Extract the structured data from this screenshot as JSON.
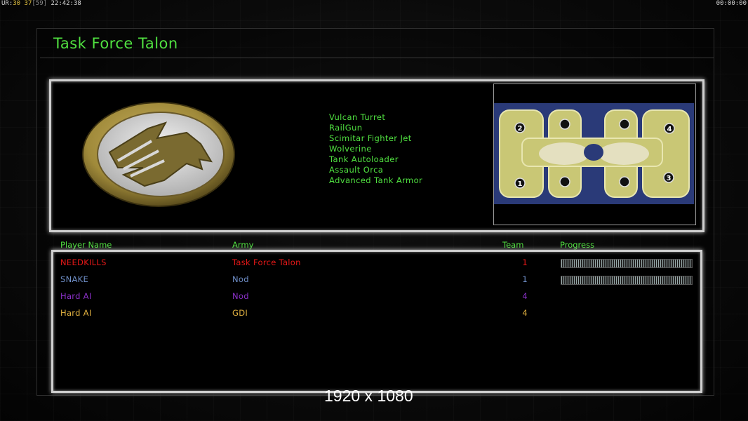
{
  "hud": {
    "prefix": "UR:",
    "fps_a": "30",
    "fps_b": "37",
    "fps_c": "[59]",
    "clock": "22:42:38",
    "timer": "00:00:00"
  },
  "title": "Task Force Talon",
  "emblem": {
    "icon": "gdi-eagle-emblem-icon",
    "ring_color": "#a9923f",
    "field_color": "#d8d8d8"
  },
  "powers": [
    "Vulcan Turret",
    "RailGun",
    "Scimitar Fighter Jet",
    "Wolverine",
    "Tank Autoloader",
    "Assault Orca",
    "Advanced Tank Armor"
  ],
  "map": {
    "start_positions": [
      "2",
      "4",
      "1",
      "3"
    ],
    "land_color": "#c9c775",
    "water_color": "#2a3a78"
  },
  "columns": {
    "player": "Player Name",
    "army": "Army",
    "team": "Team",
    "progress": "Progress"
  },
  "players": [
    {
      "name": "NEEDKILLS",
      "army": "Task Force Talon",
      "team": "1",
      "color": "#e81818",
      "progress_visible": true
    },
    {
      "name": "SNAKE",
      "army": "Nod",
      "team": "1",
      "color": "#6f8fc8",
      "progress_visible": true
    },
    {
      "name": "Hard AI",
      "army": "Nod",
      "team": "4",
      "color": "#8a30c8",
      "progress_visible": false
    },
    {
      "name": "Hard AI",
      "army": "GDI",
      "team": "4",
      "color": "#e0b040",
      "progress_visible": false
    }
  ],
  "resolution": "1920 x 1080"
}
